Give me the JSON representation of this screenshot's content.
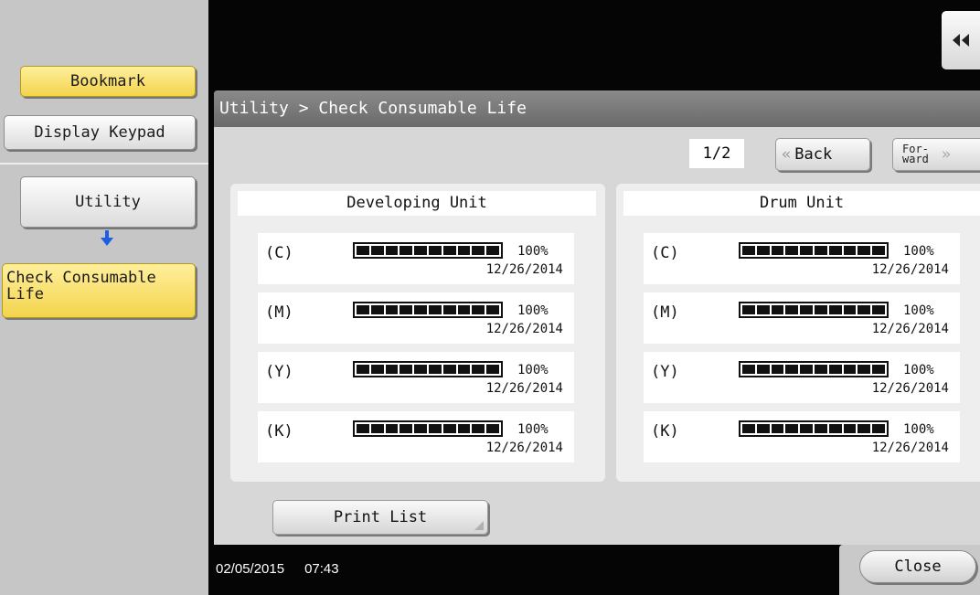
{
  "sidebar": {
    "bookmark_label": "Bookmark",
    "keypad_label": "Display Keypad",
    "utility_label": "Utility",
    "current_label_line1": "Check Consumable",
    "current_label_line2": "Life"
  },
  "title": "Utility > Check Consumable Life",
  "pagination": {
    "indicator": "1/2",
    "back_label": "Back",
    "forward_label_line1": "For-",
    "forward_label_line2": "ward"
  },
  "developing_unit": {
    "title": "Developing Unit",
    "items": [
      {
        "label": "(C)",
        "percent": 100,
        "percent_text": "100%",
        "date": "12/26/2014"
      },
      {
        "label": "(M)",
        "percent": 100,
        "percent_text": "100%",
        "date": "12/26/2014"
      },
      {
        "label": "(Y)",
        "percent": 100,
        "percent_text": "100%",
        "date": "12/26/2014"
      },
      {
        "label": "(K)",
        "percent": 100,
        "percent_text": "100%",
        "date": "12/26/2014"
      }
    ]
  },
  "drum_unit": {
    "title": "Drum Unit",
    "items": [
      {
        "label": "(C)",
        "percent": 100,
        "percent_text": "100%",
        "date": "12/26/2014"
      },
      {
        "label": "(M)",
        "percent": 100,
        "percent_text": "100%",
        "date": "12/26/2014"
      },
      {
        "label": "(Y)",
        "percent": 100,
        "percent_text": "100%",
        "date": "12/26/2014"
      },
      {
        "label": "(K)",
        "percent": 100,
        "percent_text": "100%",
        "date": "12/26/2014"
      }
    ]
  },
  "print_list_label": "Print List",
  "status": {
    "date": "02/05/2015",
    "time": "07:43"
  },
  "close_label": "Close",
  "icons": {
    "collapse": "double-chevron-left-icon",
    "step_arrow": "arrow-down-icon"
  },
  "colors": {
    "accent_yellow": "#f3d44c",
    "arrow_blue": "#1a5fe0"
  }
}
